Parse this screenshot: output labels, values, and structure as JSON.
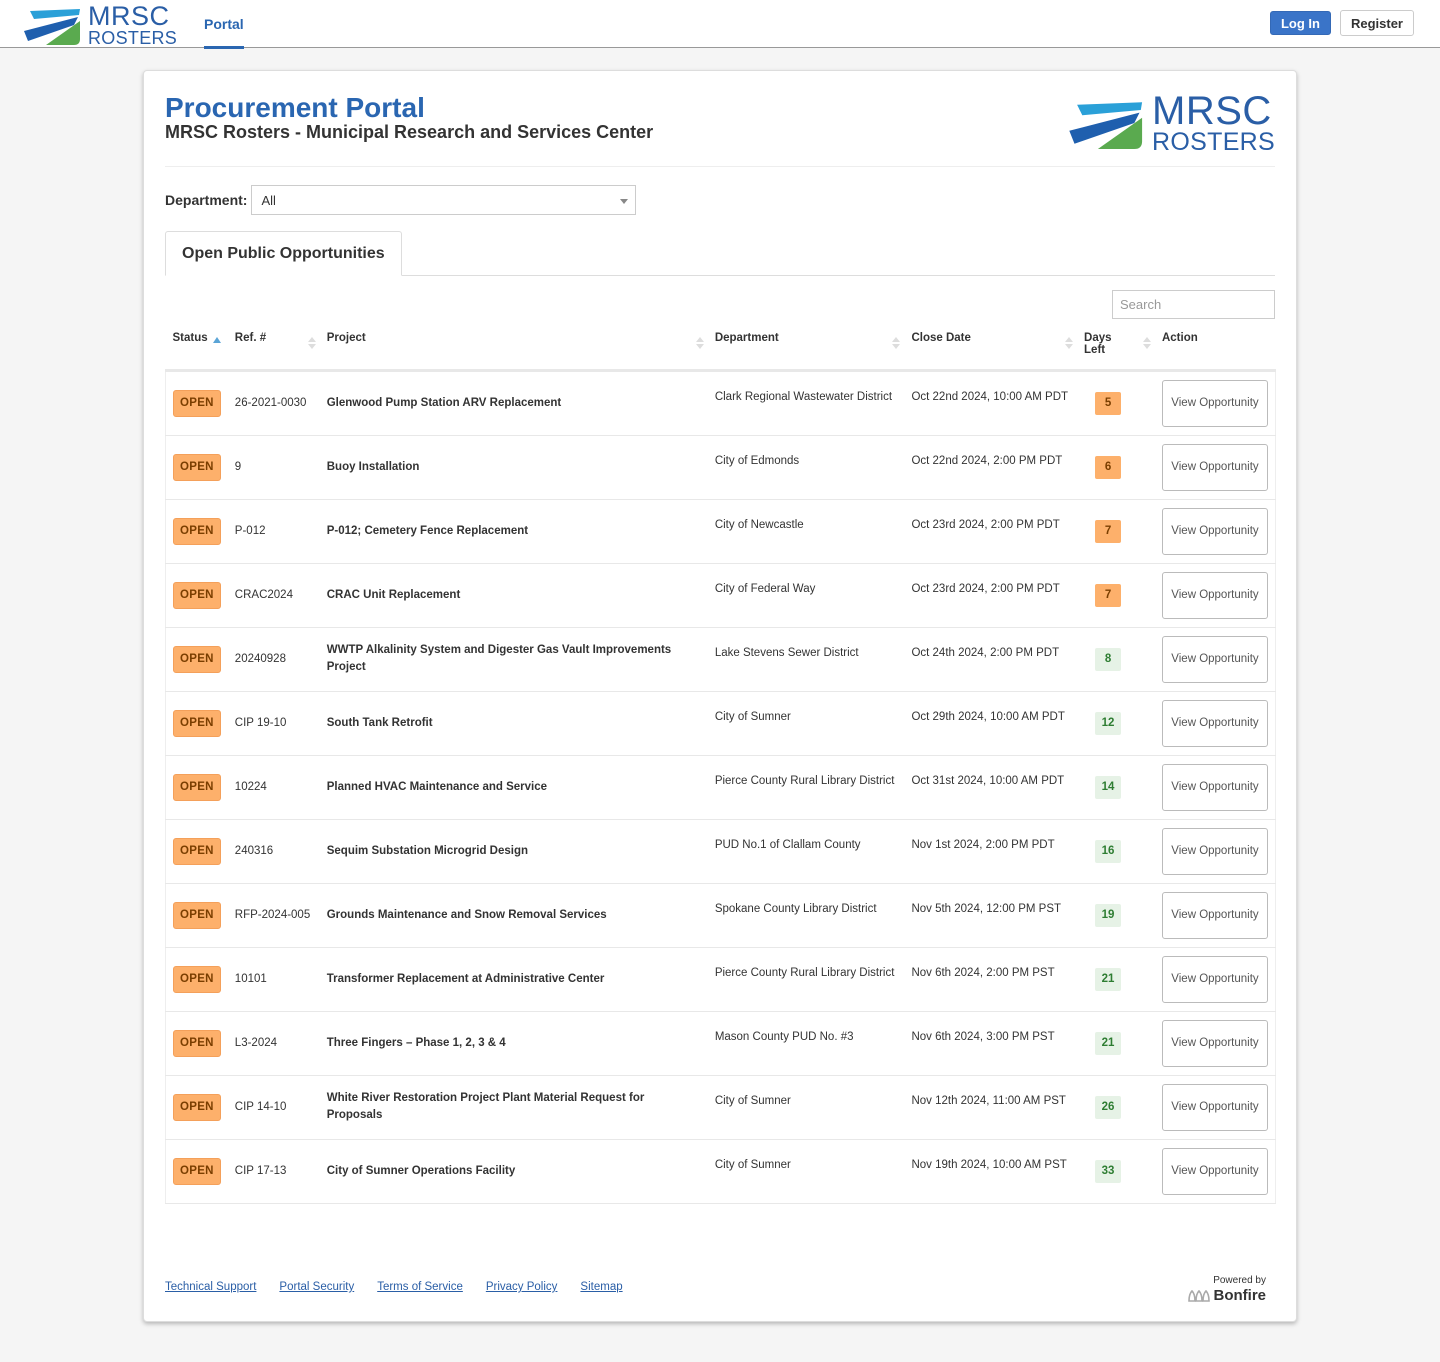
{
  "topnav": {
    "logo": {
      "line1": "MRSC",
      "line2": "ROSTERS"
    },
    "tab": "Portal",
    "login_label": "Log In",
    "register_label": "Register"
  },
  "header": {
    "title": "Procurement Portal",
    "subtitle": "MRSC Rosters - Municipal Research and Services Center",
    "logo": {
      "line1": "MRSC",
      "line2": "ROSTERS"
    }
  },
  "filter": {
    "label": "Department:",
    "selected": "All"
  },
  "tabs": {
    "active": "Open Public Opportunities"
  },
  "search": {
    "placeholder": "Search"
  },
  "table": {
    "columns": {
      "status": "Status",
      "ref": "Ref. #",
      "project": "Project",
      "department": "Department",
      "close_date": "Close Date",
      "days_left": "Days Left",
      "action": "Action"
    },
    "rows": [
      {
        "status": "OPEN",
        "ref": "26-2021-0030",
        "project": "Glenwood Pump Station ARV Replacement",
        "department": "Clark Regional Wastewater District",
        "close_date": "Oct 22nd 2024, 10:00 AM PDT",
        "days_left": "5",
        "urgency": "urgent",
        "action": "View Opportunity"
      },
      {
        "status": "OPEN",
        "ref": "9",
        "project": "Buoy Installation",
        "department": "City of Edmonds",
        "close_date": "Oct 22nd 2024, 2:00 PM PDT",
        "days_left": "6",
        "urgency": "urgent",
        "action": "View Opportunity"
      },
      {
        "status": "OPEN",
        "ref": "P-012",
        "project": "P-012; Cemetery Fence Replacement",
        "department": "City of Newcastle",
        "close_date": "Oct 23rd 2024, 2:00 PM PDT",
        "days_left": "7",
        "urgency": "urgent",
        "action": "View Opportunity"
      },
      {
        "status": "OPEN",
        "ref": "CRAC2024",
        "project": "CRAC Unit Replacement",
        "department": "City of Federal Way",
        "close_date": "Oct 23rd 2024, 2:00 PM PDT",
        "days_left": "7",
        "urgency": "urgent",
        "action": "View Opportunity"
      },
      {
        "status": "OPEN",
        "ref": "20240928",
        "project": "WWTP Alkalinity System and Digester Gas Vault Improvements Project",
        "department": "Lake Stevens Sewer District",
        "close_date": "Oct 24th 2024, 2:00 PM PDT",
        "days_left": "8",
        "urgency": "ok",
        "action": "View Opportunity"
      },
      {
        "status": "OPEN",
        "ref": "CIP 19-10",
        "project": "South Tank Retrofit",
        "department": "City of Sumner",
        "close_date": "Oct 29th 2024, 10:00 AM PDT",
        "days_left": "12",
        "urgency": "ok",
        "action": "View Opportunity"
      },
      {
        "status": "OPEN",
        "ref": "10224",
        "project": "Planned HVAC Maintenance and Service",
        "department": "Pierce County Rural Library District",
        "close_date": "Oct 31st 2024, 10:00 AM PDT",
        "days_left": "14",
        "urgency": "ok",
        "action": "View Opportunity"
      },
      {
        "status": "OPEN",
        "ref": "240316",
        "project": "Sequim Substation Microgrid Design",
        "department": "PUD No.1 of Clallam County",
        "close_date": "Nov 1st 2024, 2:00 PM PDT",
        "days_left": "16",
        "urgency": "ok",
        "action": "View Opportunity"
      },
      {
        "status": "OPEN",
        "ref": "RFP-2024-005",
        "project": "Grounds Maintenance and Snow Removal Services",
        "department": "Spokane County Library District",
        "close_date": "Nov 5th 2024, 12:00 PM PST",
        "days_left": "19",
        "urgency": "ok",
        "action": "View Opportunity"
      },
      {
        "status": "OPEN",
        "ref": "10101",
        "project": "Transformer Replacement at Administrative Center",
        "department": "Pierce County Rural Library District",
        "close_date": "Nov 6th 2024, 2:00 PM PST",
        "days_left": "21",
        "urgency": "ok",
        "action": "View Opportunity"
      },
      {
        "status": "OPEN",
        "ref": "L3-2024",
        "project": "Three Fingers – Phase 1, 2, 3 & 4",
        "department": "Mason County PUD No. #3",
        "close_date": "Nov 6th 2024, 3:00 PM PST",
        "days_left": "21",
        "urgency": "ok",
        "action": "View Opportunity"
      },
      {
        "status": "OPEN",
        "ref": "CIP 14-10",
        "project": "White River Restoration Project Plant Material Request for Proposals",
        "department": "City of Sumner",
        "close_date": "Nov 12th 2024, 11:00 AM PST",
        "days_left": "26",
        "urgency": "ok",
        "action": "View Opportunity"
      },
      {
        "status": "OPEN",
        "ref": "CIP 17-13",
        "project": "City of Sumner Operations Facility",
        "department": "City of Sumner",
        "close_date": "Nov 19th 2024, 10:00 AM PST",
        "days_left": "33",
        "urgency": "ok",
        "action": "View Opportunity"
      }
    ]
  },
  "footer": {
    "links": [
      "Technical Support",
      "Portal Security",
      "Terms of Service",
      "Privacy Policy",
      "Sitemap"
    ],
    "powered_by": "Powered by",
    "brand": "Bonfire"
  },
  "colors": {
    "brand_blue": "#2a66b1",
    "login_blue": "#3a74c8",
    "status_orange": "#fdb06b",
    "days_ok_bg": "#e6f2e6",
    "days_ok_text": "#2e7d32"
  }
}
